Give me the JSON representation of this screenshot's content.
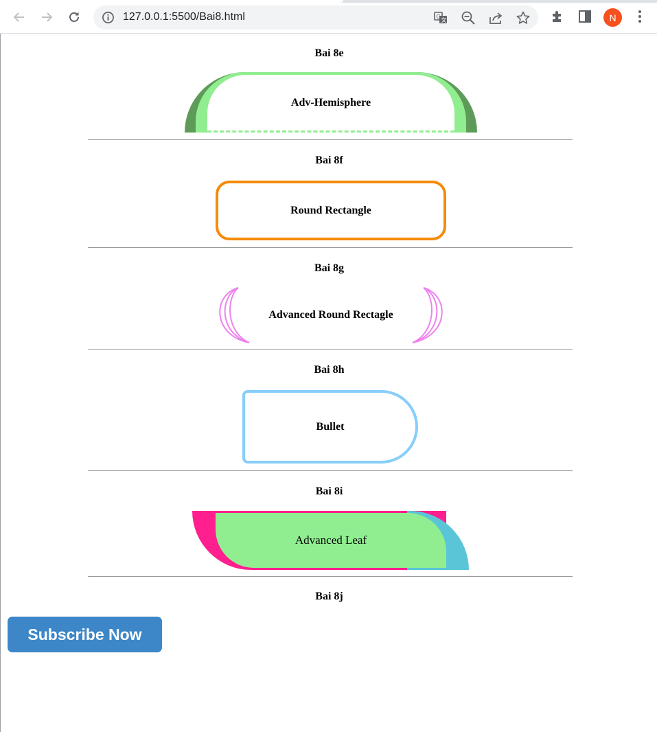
{
  "browser": {
    "url": "127.0.0.1:5500/Bai8.html",
    "profile_initial": "N",
    "profile_color": "#f4511e",
    "icons": {
      "back": "arrow-left-icon",
      "forward": "arrow-right-icon",
      "reload": "reload-icon",
      "site_info": "info-icon",
      "translate": "translate-icon",
      "zoom": "zoom-out-icon",
      "share": "share-icon",
      "bookmark": "star-icon",
      "extensions": "puzzle-icon",
      "side_panel": "side-panel-icon",
      "menu": "kebab-menu-icon"
    }
  },
  "sections": {
    "bai_8e": {
      "heading": "Bai 8e",
      "label": "Adv-Hemisphere"
    },
    "bai_8f": {
      "heading": "Bai 8f",
      "label": "Round Rectangle"
    },
    "bai_8g": {
      "heading": "Bai 8g",
      "label": "Advanced Round Rectagle"
    },
    "bai_8h": {
      "heading": "Bai 8h",
      "label": "Bullet"
    },
    "bai_8i": {
      "heading": "Bai 8i",
      "label": "Advanced Leaf"
    },
    "bai_8j": {
      "heading": "Bai 8j",
      "button_label": "Subscribe Now"
    }
  },
  "colors": {
    "hemisphere_dark": "#5e9b59",
    "hemisphere_light": "#90ee90",
    "round_rect_border": "#f48b0c",
    "adv_round_arcs": "#ee82ee",
    "bullet_border": "#87cefa",
    "leaf_pink": "#ff1f8e",
    "leaf_blue": "#5bc5d8",
    "leaf_green": "#90ee90",
    "subscribe_bg": "#3d87c9"
  }
}
